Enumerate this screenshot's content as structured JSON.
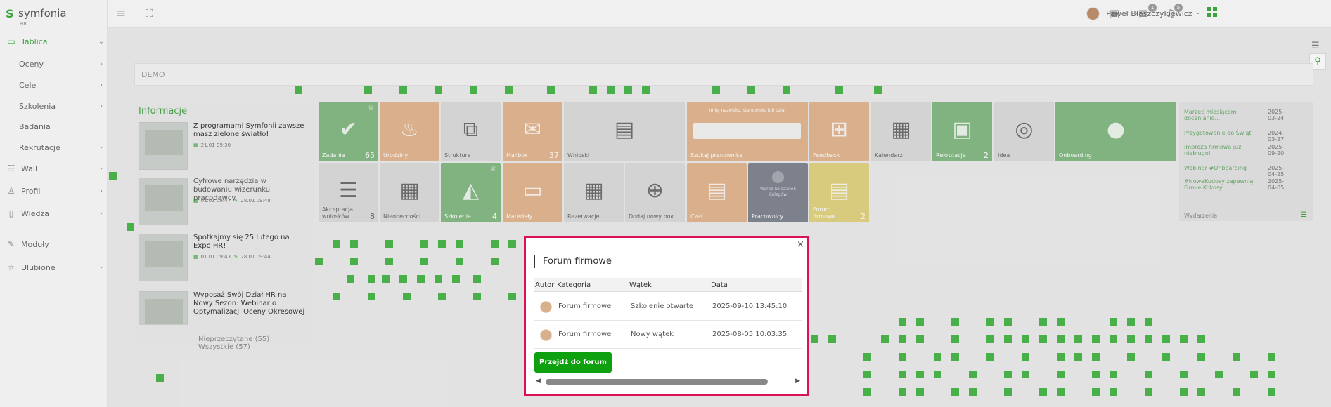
{
  "app": {
    "logo_name": "symfonia",
    "logo_sub": "HR",
    "logo_mark": "S"
  },
  "sidebar": {
    "items": [
      {
        "label": "Tablica",
        "icon": "monitor-icon",
        "glyph": "▭",
        "chev": "⌄"
      },
      {
        "label": "Oceny",
        "chev": "›"
      },
      {
        "label": "Cele",
        "chev": "›"
      },
      {
        "label": "Szkolenia",
        "chev": "›"
      },
      {
        "label": "Badania",
        "chev": ""
      },
      {
        "label": "Rekrutacje",
        "chev": "›"
      },
      {
        "label": "Wall",
        "icon": "wall-icon",
        "glyph": "☷",
        "chev": "›"
      },
      {
        "label": "Profil",
        "icon": "user-icon",
        "glyph": "♙",
        "chev": "›"
      },
      {
        "label": "Wiedza",
        "icon": "book-icon",
        "glyph": "▯",
        "chev": "›"
      },
      {
        "label": "Moduły",
        "icon": "wrench-icon",
        "glyph": "✎",
        "chev": ""
      },
      {
        "label": "Ulubione",
        "icon": "star-icon",
        "glyph": "☆",
        "chev": "›"
      }
    ]
  },
  "topbar": {
    "menu_glyph": "≡",
    "expand_glyph": "⛶",
    "clipboard_glyph": "▣",
    "chat_glyph": "▤",
    "bell_glyph": "♫",
    "chat_badge": "1",
    "bell_badge": "5",
    "user_name": "Paweł Błaszczykiewicz",
    "chev": "⌄"
  },
  "demo_label": "DEMO",
  "tools": {
    "tune_glyph": "☰",
    "bulb_glyph": "⚲"
  },
  "info": {
    "title": "Informacje",
    "news": [
      {
        "title": "Z programami Symfonii zawsze masz zielone światło!",
        "date1": "21.01 09:30",
        "date2": ""
      },
      {
        "title": "Cyfrowe narzędzia w budowaniu wizerunku pracodawcy",
        "date1": "01.01 09:47",
        "date2": "28.01 09:48"
      },
      {
        "title": "Spotkajmy się 25 lutego na Expo HR!",
        "date1": "01.01 09:43",
        "date2": "28.01 09:44"
      },
      {
        "title": "Wyposaż Swój Dział HR na Nowy Sezon: Webinar o Optymalizacji Oceny Okresowej",
        "date1": "",
        "date2": ""
      }
    ],
    "unread": "Nieprzeczytane (55)",
    "all": "Wszystkie (57)"
  },
  "tiles": [
    {
      "label": "Zadania",
      "count": "65",
      "glyph": "✔",
      "icon": "check-icon"
    },
    {
      "label": "Urodziny",
      "count": "",
      "glyph": "♨",
      "icon": "cake-icon"
    },
    {
      "label": "Struktura",
      "count": "",
      "glyph": "⧉",
      "icon": "structure-icon"
    },
    {
      "label": "Mailbox",
      "count": "37",
      "glyph": "✉",
      "icon": "mail-icon"
    },
    {
      "label": "Wnioski",
      "count": "",
      "glyph": "▤",
      "icon": "document-icon"
    },
    {
      "label": "Szukaj pracownika",
      "count": "",
      "glyph": "",
      "icon": "search-box"
    },
    {
      "label": "Feedback",
      "count": "",
      "glyph": "⊞",
      "icon": "feedback-icon"
    },
    {
      "label": "Kalendarz",
      "count": "",
      "glyph": "▦",
      "icon": "calendar-icon"
    },
    {
      "label": "Rekrutacje",
      "count": "2",
      "glyph": "▣",
      "icon": "folder-user-icon"
    },
    {
      "label": "Idea",
      "count": "",
      "glyph": "◎",
      "icon": "lightbulb-icon"
    },
    {
      "label": "Onboarding",
      "count": "",
      "glyph": "●",
      "icon": "bulb-icon"
    },
    {
      "label": "Akceptacja wniosków",
      "count": "8",
      "glyph": "☰",
      "icon": "list-icon"
    },
    {
      "label": "Nieobecności",
      "count": "",
      "glyph": "▦",
      "icon": "absence-icon"
    },
    {
      "label": "Szkolenia",
      "count": "4",
      "glyph": "◭",
      "icon": "graduation-icon"
    },
    {
      "label": "Materiały",
      "count": "",
      "glyph": "▭",
      "icon": "folder-icon"
    },
    {
      "label": "Rezerwacje",
      "count": "",
      "glyph": "▦",
      "icon": "reservation-icon"
    },
    {
      "label": "Dodaj nowy box",
      "count": "",
      "glyph": "⊕",
      "icon": "add-icon"
    },
    {
      "label": "Czat",
      "count": "",
      "glyph": "▤",
      "icon": "chat-icon"
    },
    {
      "label": "Pracownicy",
      "count": "",
      "glyph": "●",
      "icon": "employee-icon"
    },
    {
      "label": "Forum firmowe",
      "count": "2",
      "glyph": "▤",
      "icon": "forum-icon"
    }
  ],
  "search_tile_prompt": "Imię, nazwisko, stanowisko lub dział",
  "employee_tile_text": "Wśród koleżanek Kolegów",
  "events": {
    "title": "Wydarzenia",
    "list_glyph": "☰",
    "items": [
      {
        "title": "Marzec miesiącem docenianio...",
        "date": "2025-03-24"
      },
      {
        "title": "Przygotowanie do Świąt",
        "date": "2024-03-27"
      },
      {
        "title": "Impreza firmowa już niebługo!",
        "date": "2025-09-20"
      },
      {
        "title": "Webinar #Onboarding",
        "date": "2025-04-25"
      },
      {
        "title": "#NoweKudosy zapewnią Firmie Kokosy",
        "date": "2025-04-05"
      }
    ]
  },
  "modal": {
    "close": "×",
    "title": "Forum firmowe",
    "headers": {
      "author": "Autor",
      "category": "Kategoria",
      "thread": "Wątek",
      "date": "Data"
    },
    "rows": [
      {
        "category": "Forum firmowe",
        "thread": "Szkolenie otwarte",
        "date": "2025-09-10 13:45:10"
      },
      {
        "category": "Forum firmowe",
        "thread": "Nowy wątek",
        "date": "2025-08-05 10:03:35"
      }
    ],
    "button": "Przejdź do forum",
    "scroll_left": "◀",
    "scroll_right": "▶"
  },
  "colors": {
    "accent": "#3aa43a",
    "modal_border": "#dd1155",
    "button": "#0fa00f"
  }
}
